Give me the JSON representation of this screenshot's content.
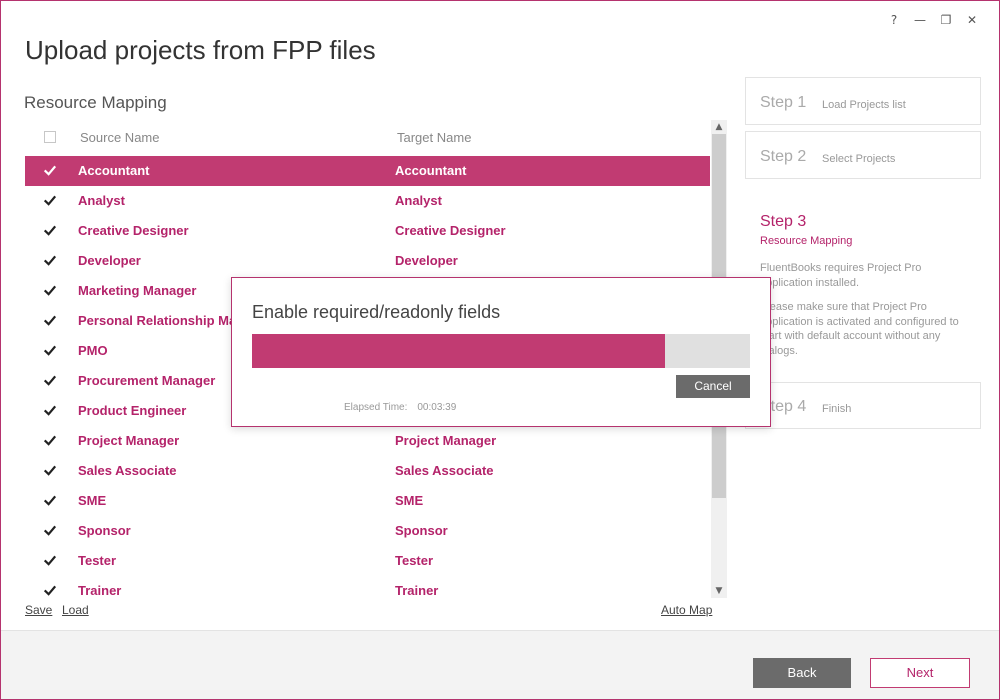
{
  "window": {
    "controls": {
      "help": "?",
      "minimize": "—",
      "restore": "❐",
      "close": "✕"
    }
  },
  "title": "Upload projects from FPP files",
  "section_title": "Resource Mapping",
  "grid": {
    "header": {
      "source": "Source Name",
      "target": "Target Name"
    },
    "rows": [
      {
        "source": "Accountant",
        "target": "Accountant",
        "checked": true,
        "selected": true
      },
      {
        "source": "Analyst",
        "target": "Analyst",
        "checked": true
      },
      {
        "source": "Creative Designer",
        "target": "Creative Designer",
        "checked": true
      },
      {
        "source": "Developer",
        "target": "Developer",
        "checked": true
      },
      {
        "source": "Marketing Manager",
        "target": "",
        "checked": true
      },
      {
        "source": "Personal Relationship Ma",
        "target": "",
        "checked": true
      },
      {
        "source": "PMO",
        "target": "",
        "checked": true
      },
      {
        "source": "Procurement Manager",
        "target": "",
        "checked": true
      },
      {
        "source": "Product Engineer",
        "target": "",
        "checked": true
      },
      {
        "source": "Project Manager",
        "target": "Project Manager",
        "checked": true
      },
      {
        "source": "Sales Associate",
        "target": "Sales Associate",
        "checked": true
      },
      {
        "source": "SME",
        "target": "SME",
        "checked": true
      },
      {
        "source": "Sponsor",
        "target": "Sponsor",
        "checked": true
      },
      {
        "source": "Tester",
        "target": "Tester",
        "checked": true
      },
      {
        "source": "Trainer",
        "target": "Trainer",
        "checked": true
      }
    ]
  },
  "links": {
    "save": "Save",
    "load": "Load",
    "auto_map": "Auto Map"
  },
  "steps": {
    "step1": {
      "num": "Step 1",
      "label": "Load Projects list"
    },
    "step2": {
      "num": "Step 2",
      "label": "Select Projects"
    },
    "step3": {
      "num": "Step 3",
      "label": "Resource Mapping",
      "desc1": "FluentBooks requires Project Pro application installed.",
      "desc2": "Please make sure that Project Pro application is activated and configured to start with default account without any dialogs."
    },
    "step4": {
      "num": "Step 4",
      "label": "Finish"
    }
  },
  "dialog": {
    "title": "Enable required/readonly fields",
    "progress": 0.83,
    "cancel": "Cancel",
    "elapsed_label": "Elapsed Time:",
    "elapsed_value": "00:03:39"
  },
  "footer": {
    "back": "Back",
    "next": "Next"
  },
  "colors": {
    "accent": "#c13b72",
    "accent_text": "#b4236a",
    "button_gray": "#6b6b6b"
  }
}
